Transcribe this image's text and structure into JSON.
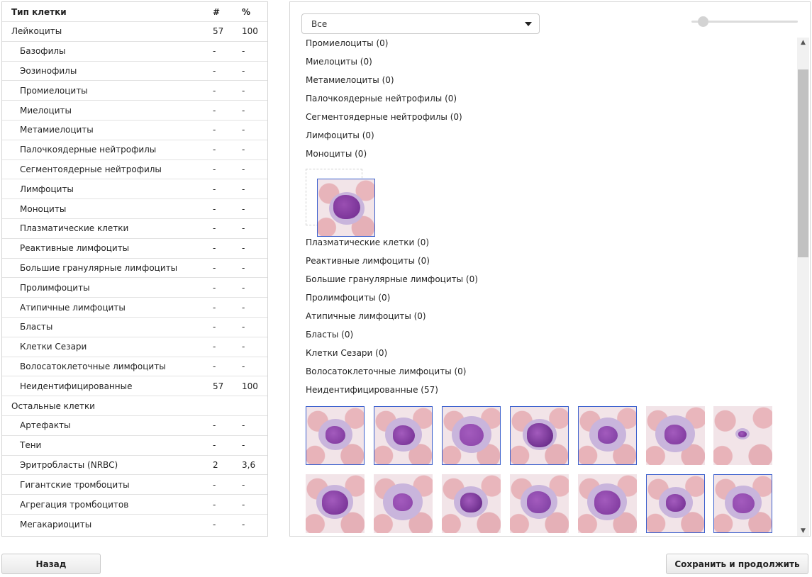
{
  "table": {
    "headers": {
      "type": "Тип клетки",
      "count": "#",
      "percent": "%"
    },
    "rows": [
      {
        "name": "Лейкоциты",
        "count": "57",
        "percent": "100",
        "level": 0
      },
      {
        "name": "Базофилы",
        "count": "-",
        "percent": "-",
        "level": 1
      },
      {
        "name": "Эозинофилы",
        "count": "-",
        "percent": "-",
        "level": 1
      },
      {
        "name": "Промиелоциты",
        "count": "-",
        "percent": "-",
        "level": 1
      },
      {
        "name": "Миелоциты",
        "count": "-",
        "percent": "-",
        "level": 1
      },
      {
        "name": "Метамиелоциты",
        "count": "-",
        "percent": "-",
        "level": 1
      },
      {
        "name": "Палочкоядерные нейтрофилы",
        "count": "-",
        "percent": "-",
        "level": 1
      },
      {
        "name": "Сегментоядерные нейтрофилы",
        "count": "-",
        "percent": "-",
        "level": 1
      },
      {
        "name": "Лимфоциты",
        "count": "-",
        "percent": "-",
        "level": 1
      },
      {
        "name": "Моноциты",
        "count": "-",
        "percent": "-",
        "level": 1
      },
      {
        "name": "Плазматические клетки",
        "count": "-",
        "percent": "-",
        "level": 1
      },
      {
        "name": "Реактивные лимфоциты",
        "count": "-",
        "percent": "-",
        "level": 1
      },
      {
        "name": "Большие гранулярные лимфоциты",
        "count": "-",
        "percent": "-",
        "level": 1
      },
      {
        "name": "Пролимфоциты",
        "count": "-",
        "percent": "-",
        "level": 1
      },
      {
        "name": "Атипичные лимфоциты",
        "count": "-",
        "percent": "-",
        "level": 1
      },
      {
        "name": "Бласты",
        "count": "-",
        "percent": "-",
        "level": 1
      },
      {
        "name": "Клетки Сезари",
        "count": "-",
        "percent": "-",
        "level": 1
      },
      {
        "name": "Волосатоклеточные лимфоциты",
        "count": "-",
        "percent": "-",
        "level": 1
      },
      {
        "name": "Неидентифицированные",
        "count": "57",
        "percent": "100",
        "level": 1
      },
      {
        "name": "Остальные клетки",
        "count": "",
        "percent": "",
        "level": 0
      },
      {
        "name": "Артефакты",
        "count": "-",
        "percent": "-",
        "level": 1
      },
      {
        "name": "Тени",
        "count": "-",
        "percent": "-",
        "level": 1
      },
      {
        "name": "Эритробласты (NRBC)",
        "count": "2",
        "percent": "3,6",
        "level": 1
      },
      {
        "name": "Гигантские тромбоциты",
        "count": "-",
        "percent": "-",
        "level": 1
      },
      {
        "name": "Агрегация тромбоцитов",
        "count": "-",
        "percent": "-",
        "level": 1
      },
      {
        "name": "Мегакариоциты",
        "count": "-",
        "percent": "-",
        "level": 1
      }
    ]
  },
  "filter": {
    "selected": "Все"
  },
  "categories": [
    "Промиелоциты (0)",
    "Миелоциты (0)",
    "Метамиелоциты (0)",
    "Палочкоядерные нейтрофилы (0)",
    "Сегментоядерные нейтрофилы (0)",
    "Лимфоциты (0)",
    "Моноциты (0)",
    "Плазматические клетки (0)",
    "Реактивные лимфоциты (0)",
    "Большие гранулярные лимфоциты (0)",
    "Пролимфоциты (0)",
    "Атипичные лимфоциты (0)",
    "Бласты (0)",
    "Клетки Сезари (0)",
    "Волосатоклеточные лимфоциты (0)",
    "Неидентифицированные (57)"
  ],
  "buttons": {
    "back": "Назад",
    "save": "Сохранить и продолжить"
  },
  "colors": {
    "selected_border": "#3a5fcd",
    "nucleus": "#7a3499"
  }
}
